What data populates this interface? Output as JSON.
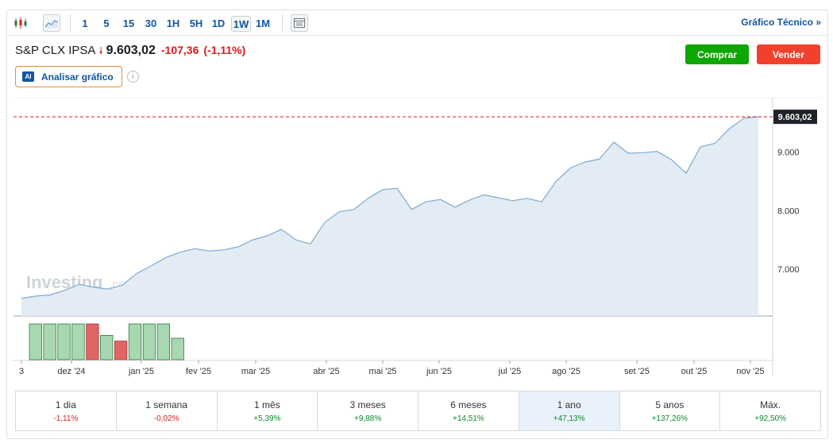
{
  "toolbar": {
    "timeframes": [
      "1",
      "5",
      "15",
      "30",
      "1H",
      "5H",
      "1D",
      "1W",
      "1M"
    ],
    "active_timeframe": "1W",
    "tech_link": "Gráfico Técnico »"
  },
  "header": {
    "name": "S&P CLX IPSA",
    "price": "9.603,02",
    "change": "-107,36",
    "change_pct": "(-1,11%)",
    "ai_label": "Analisar gráfico",
    "ai_badge": "AI",
    "buy": "Comprar",
    "sell": "Vender",
    "info": "i"
  },
  "chart_data": {
    "type": "area",
    "series": [
      {
        "values": [
          6500,
          6540,
          6560,
          6640,
          6740,
          6690,
          6660,
          6730,
          6930,
          7060,
          7200,
          7290,
          7350,
          7310,
          7330,
          7380,
          7500,
          7570,
          7680,
          7500,
          7430,
          7800,
          7980,
          8020,
          8210,
          8360,
          8380,
          8020,
          8150,
          8190,
          8060,
          8180,
          8270,
          8220,
          8170,
          8210,
          8150,
          8500,
          8730,
          8830,
          8880,
          9170,
          8980,
          8990,
          9010,
          8870,
          8640,
          9090,
          9150,
          9400,
          9580,
          9603.02
        ]
      }
    ],
    "x_ticks": [
      "3",
      "dez '24",
      "jan '25",
      "fev '25",
      "mar '25",
      "abr '25",
      "mai '25",
      "jun '25",
      "jul '25",
      "ago '25",
      "set '25",
      "out '25",
      "nov '25"
    ],
    "y_ticks": [
      "7.000",
      "8.000",
      "9.000"
    ],
    "y_tick_values": [
      7000,
      8000,
      9000
    ],
    "ylim": [
      6200,
      9930
    ],
    "last_label": "9.603,02",
    "last_value": 9603.02,
    "watermark": "Investing",
    "watermark_suffix": ".com",
    "volume": {
      "values": [
        1,
        1,
        1,
        1,
        1,
        0.68,
        0.52,
        1,
        1,
        1,
        0.6
      ],
      "directions": [
        "up",
        "up",
        "up",
        "up",
        "down",
        "up",
        "down",
        "up",
        "up",
        "up",
        "up"
      ]
    },
    "colors": {
      "line": "#7fa9cf",
      "fill": "#e3ecf5",
      "up": "#a7d8b2",
      "up_stroke": "#2c7a3d",
      "down": "#e06666",
      "down_stroke": "#a33",
      "dashed": "#e0191b"
    }
  },
  "performance": [
    {
      "label": "1 dia",
      "value": "-1,11%",
      "sign": "neg"
    },
    {
      "label": "1 semana",
      "value": "-0,02%",
      "sign": "neg"
    },
    {
      "label": "1 mês",
      "value": "+5,39%",
      "sign": "pos"
    },
    {
      "label": "3 meses",
      "value": "+9,88%",
      "sign": "pos"
    },
    {
      "label": "6 meses",
      "value": "+14,51%",
      "sign": "pos"
    },
    {
      "label": "1 ano",
      "value": "+47,13%",
      "sign": "pos",
      "active": true
    },
    {
      "label": "5 anos",
      "value": "+137,26%",
      "sign": "pos"
    },
    {
      "label": "Máx.",
      "value": "+92,50%",
      "sign": "pos"
    }
  ]
}
